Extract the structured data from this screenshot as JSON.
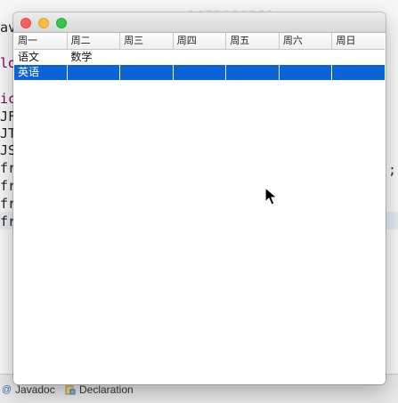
{
  "ide": {
    "watermark": "1475206281",
    "left_fragments": [
      {
        "text": "av",
        "color": "#222222"
      },
      {
        "text": "lo",
        "color": "#7f0055"
      },
      {
        "text": "",
        "color": "#222222"
      },
      {
        "text": "ic",
        "color": "#7f0055"
      },
      {
        "text": "JF",
        "color": "#222222"
      },
      {
        "text": "JT",
        "color": "#222222"
      },
      {
        "text": "JS",
        "color": "#222222"
      },
      {
        "text": "fr",
        "color": "#222222"
      },
      {
        "text": "fr",
        "color": "#222222"
      },
      {
        "text": "fr",
        "color": "#222222"
      },
      {
        "text": "fr",
        "color": "#222222"
      }
    ],
    "right_fragments": [
      {
        "text": ";"
      }
    ],
    "bottom_tabs": {
      "javadoc": {
        "icon": "at-icon",
        "label": "Javadoc"
      },
      "declaration": {
        "icon": "declaration-icon",
        "label": "Declaration"
      }
    }
  },
  "window": {
    "colors": {
      "selection": "#0b63d6",
      "close": "#fc605c",
      "minimize": "#fdbc40",
      "maximize": "#34c84a"
    },
    "table": {
      "columns": [
        "周一",
        "周二",
        "周三",
        "周四",
        "周五",
        "周六",
        "周日"
      ],
      "rows": [
        [
          "语文",
          "数学",
          "",
          "",
          "",
          "",
          ""
        ],
        [
          "英语",
          "",
          "",
          "",
          "",
          "",
          ""
        ]
      ],
      "selected_row": 1
    }
  }
}
